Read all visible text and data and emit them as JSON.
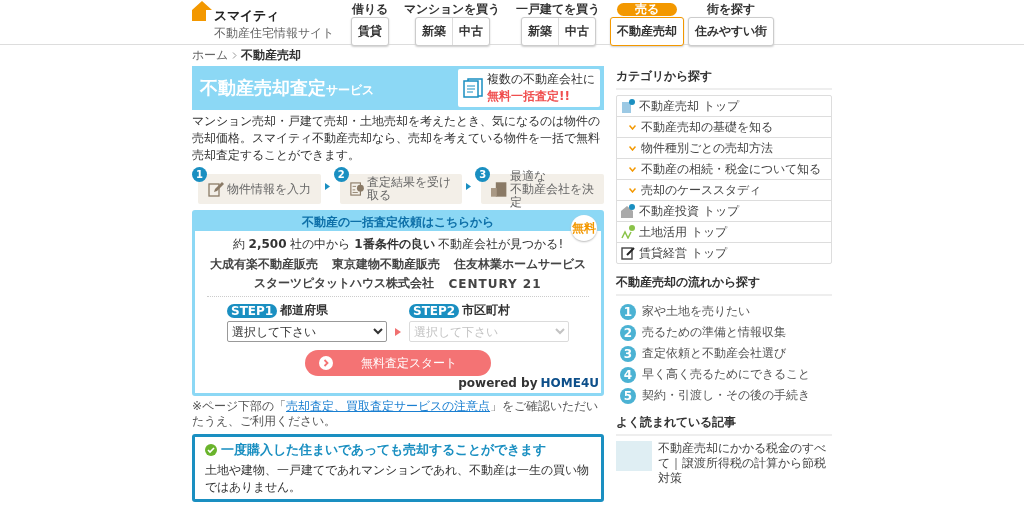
{
  "header": {
    "logo": {
      "name": "スマイティ",
      "tagline": "不動産住宅情報サイト"
    },
    "nav": [
      {
        "caption": "借りる",
        "selected": false,
        "buttons": [
          "賃貸"
        ]
      },
      {
        "caption": "マンションを買う",
        "selected": false,
        "buttons": [
          "新築",
          "中古"
        ]
      },
      {
        "caption": "一戸建てを買う",
        "selected": false,
        "buttons": [
          "新築",
          "中古"
        ]
      },
      {
        "caption": "売る",
        "selected": true,
        "buttons": [
          "不動産売却"
        ]
      },
      {
        "caption": "街を探す",
        "selected": false,
        "buttons": [
          "住みやすい街"
        ]
      }
    ]
  },
  "breadcrumb": [
    "ホーム",
    "不動産売却"
  ],
  "banner": {
    "title": "不動産売却査定",
    "suffix": "サービス",
    "note": "複数の不動産会社に",
    "note_accent": "無料一括査定!!"
  },
  "intro": "マンション売却・戸建て売却・土地売却を考えたとき、気になるのは物件の売却価格。スマイティ不動産売却なら、売却を考えている物件を一括で無料売却査定することができます。",
  "steps": [
    {
      "number": "1",
      "kind": "pencil",
      "lines": [
        "物件情報を入力"
      ]
    },
    {
      "number": "2",
      "kind": "document",
      "lines": [
        "査定結果を受け取る"
      ]
    },
    {
      "number": "3",
      "kind": "building",
      "lines": [
        "最適な",
        "不動産会社を決定"
      ]
    }
  ],
  "form": {
    "title": "不動産の一括査定依頼はこちらから",
    "badge": "無料",
    "tagline": "約 **2,500** 社の中から **1番条件の良い** 不動産会社が見つかる!",
    "companies": [
      "大成有楽不動産販売",
      "東京建物不動産販売",
      "住友林業ホームサービス",
      "スターツピタットハウス株式会社",
      "CENTURY 21"
    ],
    "fields": [
      {
        "step": "STEP1",
        "label": "都道府県",
        "placeholder": "選択して下さい",
        "disabled": false
      },
      {
        "step": "STEP2",
        "label": "市区町村",
        "placeholder": "選択して下さい",
        "disabled": true
      }
    ],
    "button": "無料査定スタート",
    "powered_by": "powered by",
    "provider": "HOME4U"
  },
  "notice": {
    "before": "※ページ下部の「",
    "link": "売却査定、買取査定サービスの注意点",
    "after": "」をご確認いただいたうえ、ご利用ください。"
  },
  "info": {
    "heading": "一度購入した住まいであっても売却することができます",
    "body": "土地や建物、一戸建てであれマンションであれ、不動産は一生の買い物ではありません。"
  },
  "sidebar": {
    "category": {
      "heading": "カテゴリから探す",
      "items": [
        {
          "kind": "top",
          "label": "不動産売却 トップ"
        },
        {
          "kind": "sub",
          "label": "不動産売却の基礎を知る"
        },
        {
          "kind": "sub",
          "label": "物件種別ごとの売却方法"
        },
        {
          "kind": "sub",
          "label": "不動産の相続・税金について知る"
        },
        {
          "kind": "sub",
          "label": "売却のケーススタディ"
        },
        {
          "kind": "top",
          "label": "不動産投資 トップ"
        },
        {
          "kind": "top",
          "label": "土地活用 トップ"
        },
        {
          "kind": "top",
          "label": "賃貸経営 トップ"
        }
      ]
    },
    "flow": {
      "heading": "不動産売却の流れから探す",
      "items": [
        {
          "number": "1",
          "label": "家や土地を売りたい"
        },
        {
          "number": "2",
          "label": "売るための準備と情報収集"
        },
        {
          "number": "3",
          "label": "査定依頼と不動産会社選び"
        },
        {
          "number": "4",
          "label": "早く高く売るためにできること"
        },
        {
          "number": "5",
          "label": "契約・引渡し・その後の手続き"
        }
      ]
    },
    "popular": {
      "heading": "よく読まれている記事",
      "articles": [
        {
          "title": "不動産売却にかかる税金のすべて｜譲渡所得税の計算から節税対策"
        }
      ]
    }
  }
}
